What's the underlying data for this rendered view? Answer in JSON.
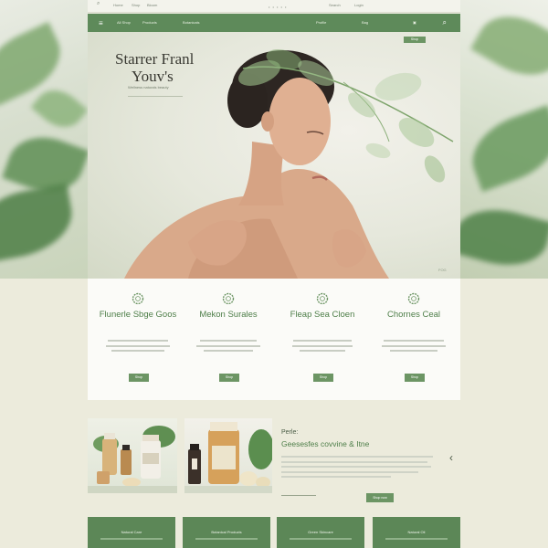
{
  "header": {
    "top_links": [
      "Home",
      "Shop",
      "Bloom"
    ],
    "top_right": [
      "Search",
      "Login"
    ],
    "dots": "• • • • •",
    "nav": [
      "All Shop",
      "Products",
      "Botanicals"
    ],
    "nav_right": "Profile",
    "nav_right_small": "Bag"
  },
  "hero": {
    "title_line1": "Starrer Franl",
    "title_line2": "Youv's",
    "subtitle": "Wellness naturals beauty",
    "cta": "Shop",
    "watermark": "FOG"
  },
  "features": [
    {
      "title": "Flunerle Sbge Goos",
      "button": "Shop"
    },
    {
      "title": "Mekon Surales",
      "button": "Shop"
    },
    {
      "title": "Fleap Sea Cloen",
      "button": "Shop"
    },
    {
      "title": "Chornes Ceal",
      "button": "Shop"
    }
  ],
  "promo": {
    "kicker": "Perle:",
    "title": "Geesesfes covvine & Itne",
    "button": "Shop now",
    "next_icon": "chevron-right"
  },
  "cards": [
    {
      "title": "Natural Care"
    },
    {
      "title": "Botanical Products"
    },
    {
      "title": "Green Skincare"
    },
    {
      "title": "Natural Oil"
    }
  ],
  "colors": {
    "accent": "#5e8a5a",
    "accent_light": "#6c9564",
    "text_green": "#4f7f4a",
    "background": "#ecebdc"
  }
}
